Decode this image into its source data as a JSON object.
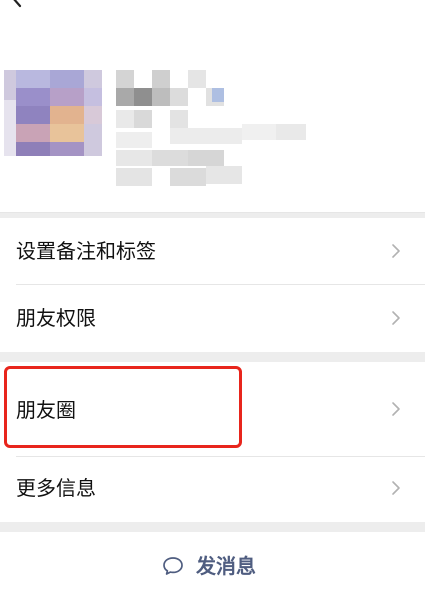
{
  "header": {
    "back_icon": "chevron-left-icon"
  },
  "menu": {
    "group1": [
      {
        "label": "设置备注和标签"
      },
      {
        "label": "朋友权限"
      }
    ],
    "group2": [
      {
        "label": "朋友圈"
      },
      {
        "label": "更多信息"
      }
    ]
  },
  "action": {
    "send_label": "发消息",
    "icon": "chat-bubble-icon"
  },
  "colors": {
    "highlight": "#e8251c",
    "send_text": "#4f5d80"
  }
}
